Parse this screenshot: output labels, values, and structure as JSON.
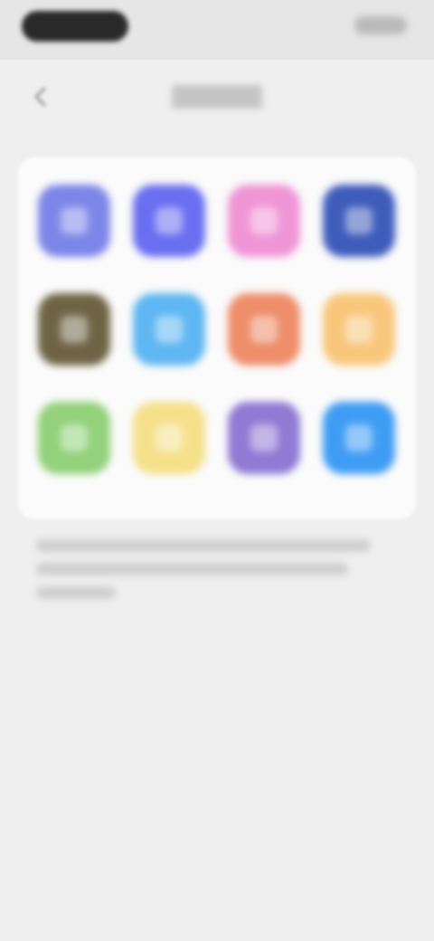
{
  "nav": {
    "back_icon": "back-arrow-icon"
  },
  "icons": [
    {
      "name": "app-icon-1",
      "color": "#7c86e8"
    },
    {
      "name": "app-icon-2",
      "color": "#6a6ef0"
    },
    {
      "name": "app-icon-3",
      "color": "#ef95d6"
    },
    {
      "name": "app-icon-4",
      "color": "#3f5cbb"
    },
    {
      "name": "app-icon-5",
      "color": "#6e6445"
    },
    {
      "name": "app-icon-6",
      "color": "#5fb6f2"
    },
    {
      "name": "app-icon-7",
      "color": "#ee8d6a"
    },
    {
      "name": "app-icon-8",
      "color": "#f8c77c"
    },
    {
      "name": "app-icon-9",
      "color": "#93d17a"
    },
    {
      "name": "app-icon-10",
      "color": "#f5e08a"
    },
    {
      "name": "app-icon-11",
      "color": "#8f7ad4"
    },
    {
      "name": "app-icon-12",
      "color": "#3f9cf4"
    }
  ]
}
